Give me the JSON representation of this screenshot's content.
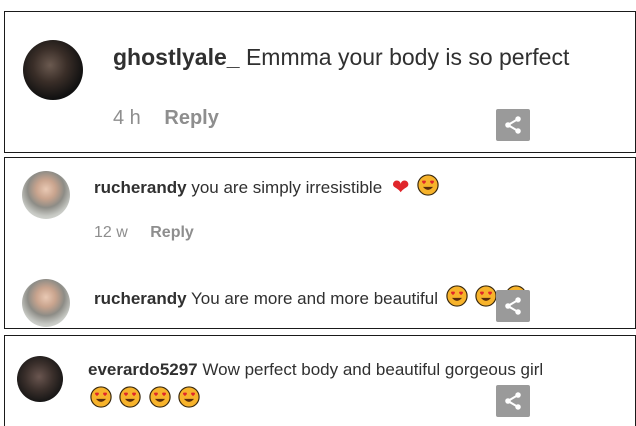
{
  "comments": [
    {
      "username": "ghostlyale_",
      "text": "Emmma your body is so perfect",
      "time": "4 h",
      "reply": "Reply"
    },
    {
      "username": "rucherandy",
      "text": "you are simply irresistible",
      "emojis": [
        "red-heart",
        "heart-eyes"
      ],
      "time": "12 w",
      "reply": "Reply"
    },
    {
      "username": "rucherandy",
      "text": "You are more and more beautiful",
      "emojis": [
        "heart-eyes",
        "heart-eyes",
        "heart-eyes"
      ]
    },
    {
      "username": "everardo5297",
      "text": "Wow perfect body and beautiful gorgeous girl",
      "emojis": [
        "heart-eyes",
        "heart-eyes",
        "heart-eyes",
        "heart-eyes"
      ]
    }
  ],
  "icons": {
    "share": "share-icon",
    "heart": "red-heart-emoji",
    "heart_eyes": "heart-eyes-emoji"
  },
  "colors": {
    "text": "#262626",
    "meta": "#8e8e8e",
    "share_bg": "#9a9a9a",
    "heart": "#e0262b",
    "emoji_face": "#f7b32b"
  }
}
